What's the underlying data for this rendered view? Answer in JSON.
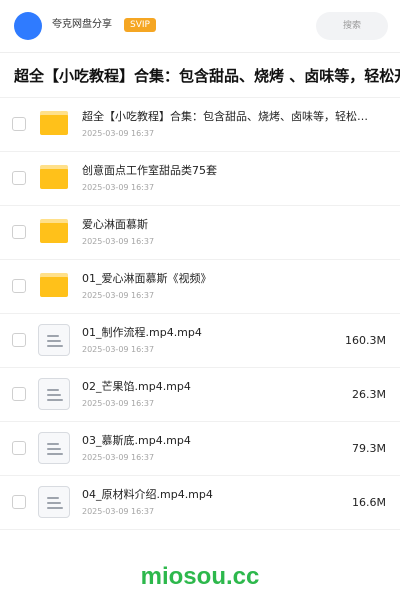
{
  "header": {
    "username": "夸克网盘分享",
    "badge": "SVIP",
    "search_placeholder": "搜索"
  },
  "page_title": "超全【小吃教程】合集：包含甜品、烧烤 、卤味等，轻松开",
  "files": [
    {
      "type": "folder",
      "name": "超全【小吃教程】合集：包含甜品、烧烤、卤味等，轻松…",
      "date": "2025-03-09 16:37",
      "size": ""
    },
    {
      "type": "folder",
      "name": "创意面点工作室甜品类75套",
      "date": "2025-03-09 16:37",
      "size": ""
    },
    {
      "type": "folder",
      "name": "爱心淋面慕斯",
      "date": "2025-03-09 16:37",
      "size": ""
    },
    {
      "type": "folder",
      "name": "01_爱心淋面慕斯《视频》",
      "date": "2025-03-09 16:37",
      "size": ""
    },
    {
      "type": "file",
      "name": "01_制作流程.mp4.mp4",
      "date": "2025-03-09 16:37",
      "size": "160.3M"
    },
    {
      "type": "file",
      "name": "02_芒果馅.mp4.mp4",
      "date": "2025-03-09 16:37",
      "size": "26.3M"
    },
    {
      "type": "file",
      "name": "03_慕斯底.mp4.mp4",
      "date": "2025-03-09 16:37",
      "size": "79.3M"
    },
    {
      "type": "file",
      "name": "04_原材料介绍.mp4.mp4",
      "date": "2025-03-09 16:37",
      "size": "16.6M"
    }
  ],
  "watermark": "miosou.cc",
  "colors": {
    "accent_blue": "#2f7bff",
    "svip_orange": "#f5a623",
    "folder_yellow": "#ffc11a",
    "watermark_green": "#2db84c"
  }
}
